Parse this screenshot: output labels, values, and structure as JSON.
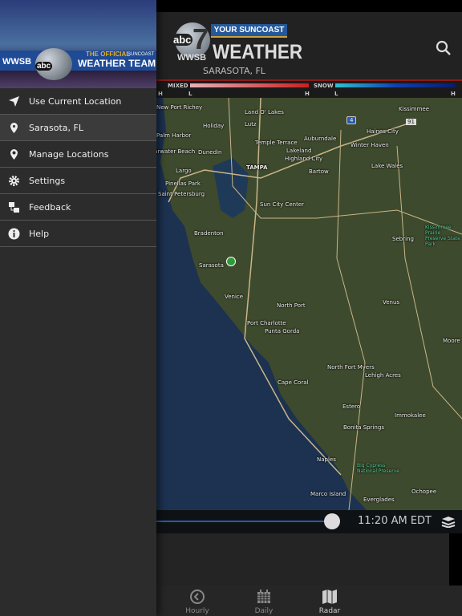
{
  "header": {
    "tagline": "YOUR SUNCOAST",
    "station": "WWSB",
    "network": "abc",
    "channel": "7",
    "title": "WEATHER",
    "location": "SARASOTA, FL"
  },
  "legend": {
    "mixed": "MIXED",
    "snow": "SNOW",
    "low": "L",
    "high": "H"
  },
  "map": {
    "labels": [
      "New Port Richey",
      "Land O' Lakes",
      "Holiday",
      "Lutz",
      "Palm Harbor",
      "Temple Terrace",
      "Auburndale",
      "Haines City",
      "Winter Haven",
      "Kissimmee",
      "Clearwater Beach",
      "Dunedin",
      "Lakeland",
      "Highland City",
      "Largo",
      "TAMPA",
      "Bartow",
      "Lake Wales",
      "Pinellas Park",
      "Saint Petersburg",
      "Sun City Center",
      "Kissimmee Prairie Preserve State Park",
      "Bradenton",
      "Sebring",
      "Sarasota",
      "Venice",
      "North Port",
      "Venus",
      "Port Charlotte",
      "Punta Gorda",
      "Moore",
      "Cape Coral",
      "North Fort Myers",
      "Lehigh Acres",
      "Estero",
      "Immokalee",
      "Bonita Springs",
      "Naples",
      "Big Cypress National Preserve",
      "Marco Island",
      "Ochopee",
      "Everglades"
    ],
    "shields": [
      "4",
      "91"
    ],
    "colors": {
      "marker": "#2e9a3a"
    }
  },
  "timeline": {
    "time": "11:20 AM EDT",
    "progress": 0.95
  },
  "tabs": [
    {
      "label": "Hourly",
      "icon": "clock-back-icon"
    },
    {
      "label": "Daily",
      "icon": "calendar-icon"
    },
    {
      "label": "Radar",
      "icon": "map-icon"
    }
  ],
  "drawer": {
    "banner": {
      "station": "WWSB",
      "official": "THE OFFICIAL",
      "suncoast": "SUNCOAST",
      "team": "WEATHER TEAM",
      "network": "abc"
    },
    "items": [
      {
        "label": "Use Current Location"
      },
      {
        "label": "Sarasota, FL"
      },
      {
        "label": "Manage Locations"
      },
      {
        "label": "Settings"
      },
      {
        "label": "Feedback"
      },
      {
        "label": "Help"
      }
    ]
  }
}
